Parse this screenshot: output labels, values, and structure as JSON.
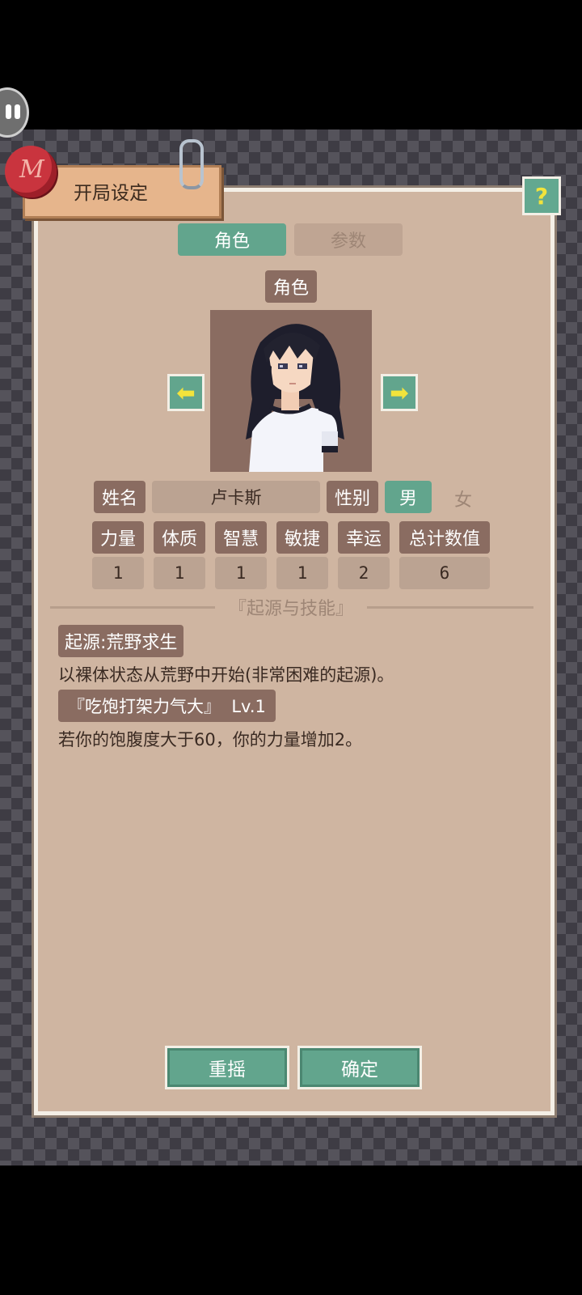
{
  "header": {
    "title": "开局设定",
    "seal_letter": "M",
    "help_label": "?"
  },
  "tabs": [
    {
      "label": "角色",
      "active": true
    },
    {
      "label": "参数",
      "active": false
    }
  ],
  "character": {
    "section_label": "角色",
    "prev_arrow": "⬅",
    "next_arrow": "➡",
    "name_label": "姓名",
    "name_value": "卢卡斯",
    "gender_label": "性别",
    "gender_male": "男",
    "gender_female": "女",
    "gender_selected": "男"
  },
  "stats": {
    "labels": [
      "力量",
      "体质",
      "智慧",
      "敏捷",
      "幸运",
      "总计数值"
    ],
    "values": [
      "1",
      "1",
      "1",
      "1",
      "2",
      "6"
    ]
  },
  "origin_skills": {
    "section_title": "『起源与技能』",
    "origin_label": "起源:荒野求生",
    "origin_desc": "以裸体状态从荒野中开始(非常困难的起源)。",
    "skill_label": "『吃饱打架力气大』  Lv.1",
    "skill_desc": "若你的饱腹度大于60，你的力量增加2。"
  },
  "buttons": {
    "reroll": "重摇",
    "confirm": "确定"
  },
  "colors": {
    "accent_green": "#62a58d",
    "panel_bg": "#cfb5a1",
    "chip_brown": "#8a6c61",
    "arrow_yellow": "#f2e33c"
  }
}
